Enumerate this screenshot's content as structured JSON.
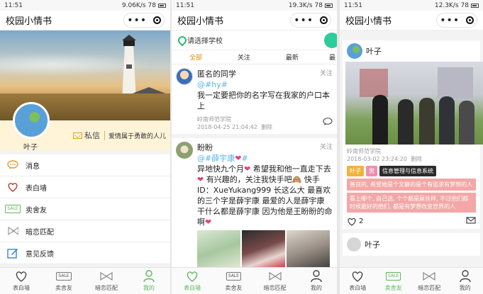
{
  "panel1": {
    "status": {
      "time": "11:51",
      "speed": "9.06K/s",
      "battery": "78"
    },
    "app_title": "校园小情书",
    "user": {
      "name": "叶子"
    },
    "message_label": "私信",
    "motto": "爱情属于勇敢的人儿",
    "menu": [
      {
        "label": "消息",
        "icon": "chat-bubble-icon"
      },
      {
        "label": "表白墙",
        "icon": "heart-icon"
      },
      {
        "label": "卖舍友",
        "icon": "sale-icon"
      },
      {
        "label": "暗恋匹配",
        "icon": "bow-icon"
      },
      {
        "label": "意见反馈",
        "icon": "edit-icon"
      }
    ],
    "tabs": [
      {
        "label": "表白墙"
      },
      {
        "label": "卖舍友"
      },
      {
        "label": "暗恋匹配"
      },
      {
        "label": "我的"
      }
    ]
  },
  "panel2": {
    "status": {
      "time": "11:51",
      "speed": "19.3K/s",
      "battery": "78"
    },
    "app_title": "校园小情书",
    "search_placeholder": "请选择学校",
    "categories": [
      "全部",
      "关注",
      "最新",
      "最"
    ],
    "posts": [
      {
        "name": "匿名的同学",
        "follow": "关注",
        "tag": "@#hy#",
        "text": "我一定要把你的名字写在我家的户口本上",
        "school": "岭南师范学院",
        "time": "2018-04-25 21:04:42",
        "delete": "删除"
      },
      {
        "name": "盼盼",
        "follow": "关注",
        "tag": "@#薛宇康",
        "tag_end": "#",
        "text1": "异地快九个月",
        "text2": "希望我和他一直走下去",
        "text3": "有兴趣的，关注我快手吧",
        "text4": "快手ID：XueYukang999 长这么大 最喜欢的三个字是薛宇康 最爱的人是薛宇康 干什么都是薛宇康 因为他是王盼盼的命啊"
      }
    ],
    "tabs": [
      {
        "label": "表白墙"
      },
      {
        "label": "卖舍友"
      },
      {
        "label": "暗恋匹配"
      },
      {
        "label": "我的"
      }
    ]
  },
  "panel3": {
    "status": {
      "time": "11:51",
      "speed": "12.3K/s",
      "battery": "78"
    },
    "app_title": "校园小情书",
    "card": {
      "name": "叶子",
      "school": "岭南师范学院",
      "time": "2018-03-02 23:24:20",
      "delete": "删除",
      "chips": [
        "叶子",
        "男",
        "信息管理与信息系统"
      ],
      "desc1": "善良的, 希望她是个文静的是个有追求有梦想的人",
      "desc2": "看上哪个, 自己选, 个个都是屌丝样, 不过他们都时候最好的他们, 都是有梦想改变世界的人",
      "likes": "2"
    },
    "next_name": "叶子",
    "tabs": [
      {
        "label": "表白墙"
      },
      {
        "label": "卖舍友"
      },
      {
        "label": "暗恋匹配"
      },
      {
        "label": "我的"
      }
    ]
  },
  "colors": {
    "accent_green": "#5cb85c",
    "tag_blue": "#59b3e6",
    "heart_pink": "#e0457b",
    "active_orange": "#e68a00"
  }
}
